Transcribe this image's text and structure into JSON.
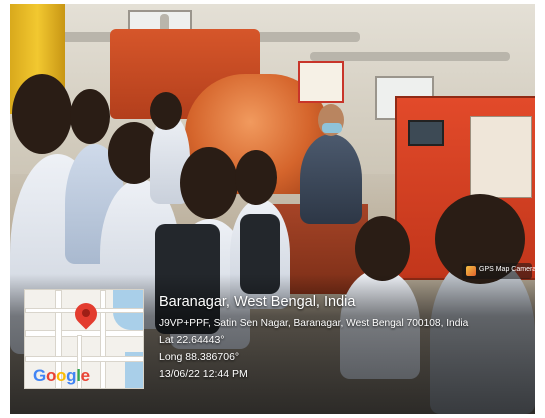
{
  "gps_badge": {
    "label": "GPS Map Camera",
    "icon": "camera-icon"
  },
  "map": {
    "logo": {
      "g": "G",
      "o1": "o",
      "o2": "o",
      "g2": "g",
      "l": "l",
      "e": "e"
    },
    "pin_icon": "map-pin-icon",
    "pin_color": "#e33c2f"
  },
  "location": {
    "title": "Baranagar, West Bengal, India",
    "address": "J9VP+PPF, Satin Sen Nagar, Baranagar, West Bengal 700108, India",
    "lat": "Lat 22.64443°",
    "long": "Long 88.386706°",
    "datetime": "13/06/22 12:44 PM"
  }
}
